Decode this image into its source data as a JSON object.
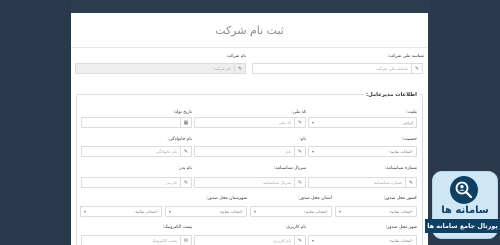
{
  "form": {
    "title": "ثبت نام شرکت",
    "company_national_id": {
      "label": "شناسه ملی شرکت:",
      "placeholder": "شناسه ملی شرکت"
    },
    "company_name": {
      "label": "نام شرکت",
      "placeholder": "نام شرکت"
    },
    "manager_section": "اطلاعات مدیرعامل:",
    "nationality": {
      "label": "ملیت:",
      "value": "ایرانی"
    },
    "national_code": {
      "label": "کد ملی:",
      "placeholder": "کد ملی"
    },
    "birth_date": {
      "label": "تاریخ تولد:"
    },
    "gender": {
      "label": "جنسیت:",
      "value": "-انتخاب نمایید-"
    },
    "first_name": {
      "label": "نام:",
      "placeholder": "نام"
    },
    "last_name": {
      "label": "نام خانوادگی:",
      "placeholder": "نام خانوادگی"
    },
    "id_number": {
      "label": "شماره شناسنامه:",
      "placeholder": "شماره شناسنامه"
    },
    "id_serial": {
      "label": "سریال شناسنامه:",
      "placeholder": "سریال شناسنامه"
    },
    "father_name": {
      "label": "نام پدر:",
      "placeholder": "نام پدر"
    },
    "issue_country": {
      "label": "کشور محل صدور:",
      "value": "-انتخاب نمایید-"
    },
    "issue_province": {
      "label": "استان محل صدور:",
      "value": "-انتخاب نمایید-"
    },
    "issue_city_county": {
      "label": "شهرستان محل صدور:",
      "value": "-انتخاب نمایید-"
    },
    "issue_city": {
      "label": "شهر محل صدور:",
      "value": "-انتخاب نمایید-"
    },
    "username": {
      "label": "نام کاربری:",
      "placeholder": "نام کاربری"
    },
    "email": {
      "label": "پست الکترونیک:",
      "placeholder": "پست الکترونیک"
    }
  },
  "logo": {
    "title": "سامانه ها",
    "subtitle": "پورتال جامع سامانه ها",
    "colors": {
      "primary": "#0f3f62",
      "badge": "#cfe7f4"
    }
  }
}
